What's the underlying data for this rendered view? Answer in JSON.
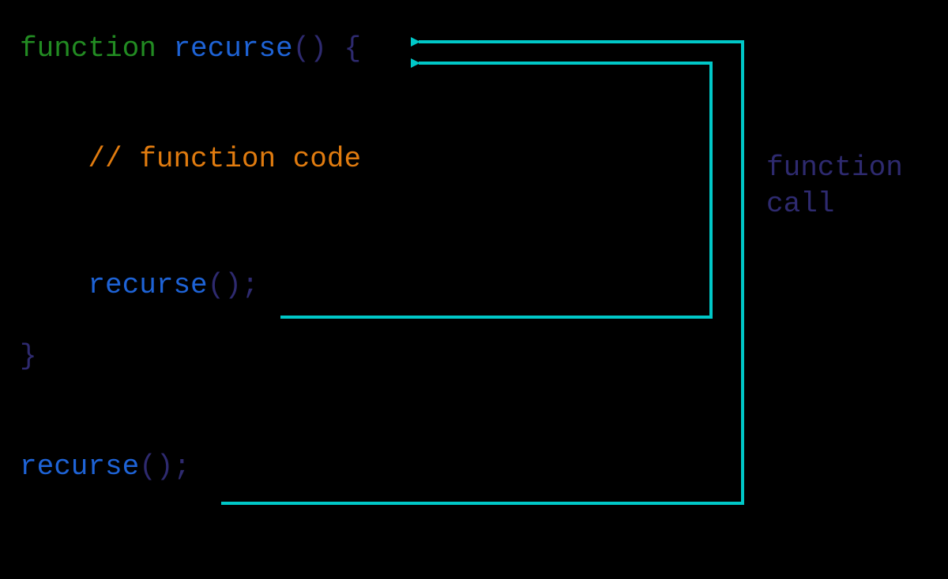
{
  "code": {
    "keyword": "function",
    "name": "recurse",
    "parens": "()",
    "openBrace": " {",
    "closeBrace": "}",
    "comment": "// function code",
    "innerCall": "recurse",
    "innerCallTail": "();",
    "outerCall": "recurse",
    "outerCallTail": "();",
    "indent": "    ",
    "space": " "
  },
  "label": {
    "line1": "function",
    "line2": "call"
  },
  "colors": {
    "arrow": "#00c8c8"
  }
}
